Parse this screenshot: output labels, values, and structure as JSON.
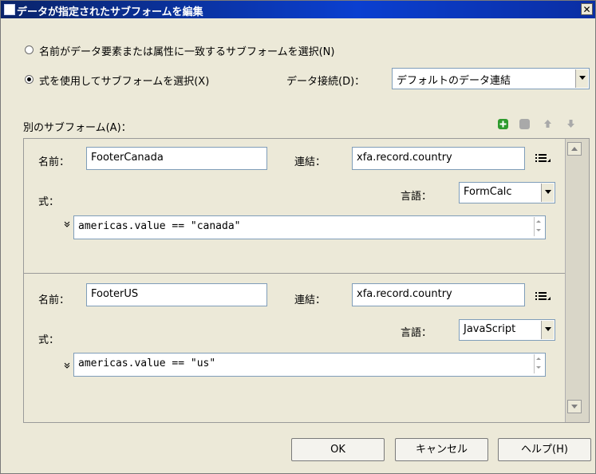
{
  "window": {
    "title": "データが指定されたサブフォームを編集",
    "close_glyph": "✕"
  },
  "options": {
    "radio_name_match": "名前がデータ要素または属性に一致するサブフォームを選択(N)",
    "radio_expression": "式を使用してサブフォームを選択(X)",
    "radio_selected": "expression"
  },
  "connection": {
    "label": "データ接続(D)：",
    "selected": "デフォルトのデータ連結"
  },
  "alt_subforms": {
    "label": "別のサブフォーム(A)：",
    "toolbar": {
      "icons": [
        "add-icon",
        "remove-icon",
        "move-up-icon",
        "move-down-icon"
      ],
      "accent_color": "#2e9b2e"
    },
    "items": [
      {
        "name_label": "名前：",
        "name_value": "FooterCanada",
        "binding_label": "連結：",
        "binding_value": "xfa.record.country",
        "expression_label": "式：",
        "language_label": "言語：",
        "language_value": "FormCalc",
        "expression_value": "americas.value == \"canada\""
      },
      {
        "name_label": "名前：",
        "name_value": "FooterUS",
        "binding_label": "連結：",
        "binding_value": "xfa.record.country",
        "expression_label": "式：",
        "language_label": "言語：",
        "language_value": "JavaScript",
        "expression_value": "americas.value == \"us\""
      }
    ]
  },
  "buttons": {
    "ok": "OK",
    "cancel": "キャンセル",
    "help": "ヘルプ(H)"
  }
}
